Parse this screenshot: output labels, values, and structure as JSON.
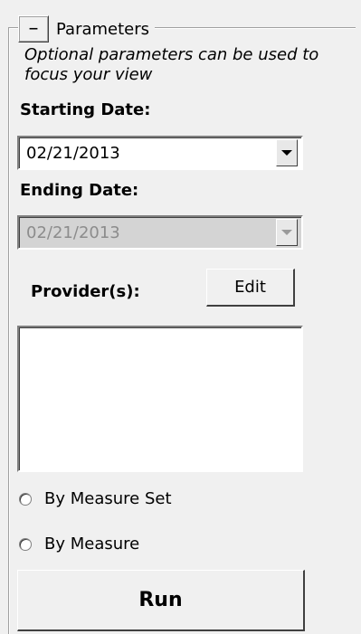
{
  "group": {
    "toggle_symbol": "–",
    "title": "Parameters",
    "description": "Optional parameters can be used to focus your view"
  },
  "starting_date": {
    "label": "Starting Date:",
    "value": "02/21/2013"
  },
  "ending_date": {
    "label": "Ending Date:",
    "value": "02/21/2013",
    "disabled": true
  },
  "providers": {
    "label": "Provider(s):",
    "edit_label": "Edit",
    "items": []
  },
  "options": [
    {
      "label": "By Measure Set",
      "checked": false
    },
    {
      "label": "By Measure",
      "checked": false
    }
  ],
  "run_label": "Run",
  "icons": [
    "collapse-icon",
    "dropdown-arrow-icon",
    "radio-icon"
  ]
}
